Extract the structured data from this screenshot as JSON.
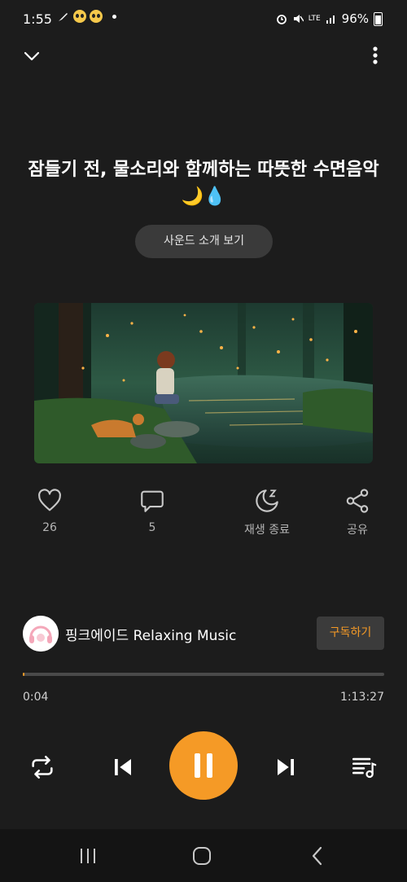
{
  "status": {
    "time": "1:55",
    "battery": "96%",
    "network": "LTE"
  },
  "track": {
    "title": "잠들기 전, 물소리와 함께하는 따뜻한 수면음악 🌙💧",
    "intro_button": "사운드 소개 보기"
  },
  "actions": {
    "like_count": "26",
    "comment_count": "5",
    "sleep_timer_label": "재생 종료",
    "share_label": "공유"
  },
  "channel": {
    "name": "핑크에이드 Relaxing Music",
    "subscribe_label": "구독하기"
  },
  "player": {
    "current_time": "0:04",
    "total_time": "1:13:27",
    "progress_fraction": 0.001,
    "state": "playing"
  },
  "colors": {
    "accent": "#f59a26",
    "background": "#1c1c1c"
  },
  "icons": {
    "collapse": "chevron-down-icon",
    "more": "more-vert-icon",
    "like": "heart-icon",
    "comment": "comment-icon",
    "sleep_timer": "moon-zz-icon",
    "share": "share-icon",
    "repeat": "repeat-icon",
    "previous": "skip-previous-icon",
    "pause": "pause-icon",
    "next": "skip-next-icon",
    "playlist": "playlist-icon"
  }
}
